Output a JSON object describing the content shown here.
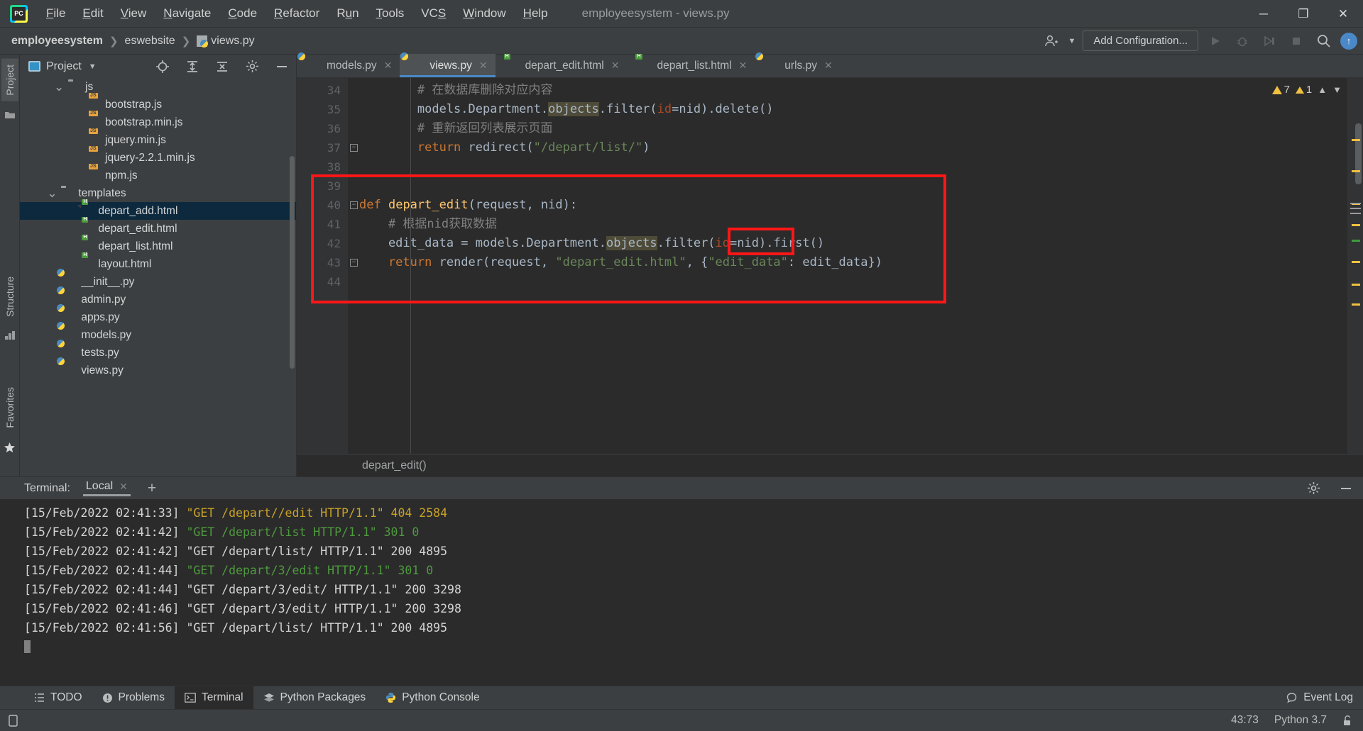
{
  "window": {
    "title": "employeesystem - views.py",
    "logo": "pycharm-logo",
    "controls": {
      "minimize": "─",
      "maximize": "❐",
      "close": "✕"
    }
  },
  "menu": [
    {
      "label": "File",
      "mnemonic": "F"
    },
    {
      "label": "Edit",
      "mnemonic": "E"
    },
    {
      "label": "View",
      "mnemonic": "V"
    },
    {
      "label": "Navigate",
      "mnemonic": "N"
    },
    {
      "label": "Code",
      "mnemonic": "C"
    },
    {
      "label": "Refactor",
      "mnemonic": "R"
    },
    {
      "label": "Run",
      "mnemonic": "u"
    },
    {
      "label": "Tools",
      "mnemonic": "T"
    },
    {
      "label": "VCS",
      "mnemonic": "S"
    },
    {
      "label": "Window",
      "mnemonic": "W"
    },
    {
      "label": "Help",
      "mnemonic": "H"
    }
  ],
  "navbar": {
    "breadcrumbs": [
      "employeesystem",
      "eswebsite",
      "views.py"
    ],
    "add_configuration": "Add Configuration...",
    "icons": [
      "user-icon",
      "run-icon",
      "debug-icon",
      "coverage-icon",
      "stop-icon",
      "search-icon",
      "updates-icon"
    ]
  },
  "sidebar": {
    "rail_tabs": [
      "Project",
      "Structure",
      "Favorites"
    ],
    "panel_title": "Project",
    "tools": [
      "locate-icon",
      "expand-all-icon",
      "collapse-all-icon",
      "settings-icon",
      "hide-icon"
    ],
    "tree": [
      {
        "label": "js",
        "type": "folder",
        "indent": 2,
        "expanded": true,
        "selected": false
      },
      {
        "label": "bootstrap.js",
        "type": "js",
        "indent": 4,
        "selected": false
      },
      {
        "label": "bootstrap.min.js",
        "type": "js",
        "indent": 4,
        "selected": false
      },
      {
        "label": "jquery.min.js",
        "type": "js",
        "indent": 4,
        "selected": false
      },
      {
        "label": "jquery-2.2.1.min.js",
        "type": "js",
        "indent": 4,
        "selected": false
      },
      {
        "label": "npm.js",
        "type": "js",
        "indent": 4,
        "selected": false
      },
      {
        "label": "templates",
        "type": "folder",
        "indent": 1.6,
        "expanded": true,
        "selected": false
      },
      {
        "label": "depart_add.html",
        "type": "html",
        "indent": 3.6,
        "selected": true
      },
      {
        "label": "depart_edit.html",
        "type": "html",
        "indent": 3.6,
        "selected": false
      },
      {
        "label": "depart_list.html",
        "type": "html",
        "indent": 3.6,
        "selected": false
      },
      {
        "label": "layout.html",
        "type": "html",
        "indent": 3.6,
        "selected": false
      },
      {
        "label": "__init__.py",
        "type": "py",
        "indent": 2.6,
        "selected": false
      },
      {
        "label": "admin.py",
        "type": "py",
        "indent": 2.6,
        "selected": false
      },
      {
        "label": "apps.py",
        "type": "py",
        "indent": 2.6,
        "selected": false
      },
      {
        "label": "models.py",
        "type": "py",
        "indent": 2.6,
        "selected": false
      },
      {
        "label": "tests.py",
        "type": "py",
        "indent": 2.6,
        "selected": false
      },
      {
        "label": "views.py",
        "type": "py",
        "indent": 2.6,
        "selected": false
      }
    ]
  },
  "editor": {
    "tabs": [
      {
        "label": "models.py",
        "type": "py",
        "active": false,
        "closable": true
      },
      {
        "label": "views.py",
        "type": "py",
        "active": true,
        "closable": true
      },
      {
        "label": "depart_edit.html",
        "type": "html",
        "active": false,
        "closable": true
      },
      {
        "label": "depart_list.html",
        "type": "html",
        "active": false,
        "closable": true
      },
      {
        "label": "urls.py",
        "type": "py",
        "active": false,
        "closable": true
      }
    ],
    "inspections": {
      "warnings": "7",
      "weak_warnings": "1"
    },
    "first_line_number": 34,
    "lines": [
      {
        "n": 34,
        "fold": false,
        "tokens": [
          {
            "t": "        # ",
            "c": "com"
          },
          {
            "t": "在数据库删除对应内容",
            "c": "com"
          }
        ]
      },
      {
        "n": 35,
        "fold": false,
        "tokens": [
          {
            "t": "        models.Department.",
            "c": "id"
          },
          {
            "t": "objects",
            "c": "hl"
          },
          {
            "t": ".filter(",
            "c": "id"
          },
          {
            "t": "id",
            "c": "arg"
          },
          {
            "t": "=nid).delete()",
            "c": "id"
          }
        ]
      },
      {
        "n": 36,
        "fold": false,
        "tokens": [
          {
            "t": "        # ",
            "c": "com"
          },
          {
            "t": "重新返回列表展示页面",
            "c": "com"
          }
        ]
      },
      {
        "n": 37,
        "fold": true,
        "tokens": [
          {
            "t": "        return",
            "c": "kw"
          },
          {
            "t": " redirect(",
            "c": "id"
          },
          {
            "t": "\"/depart/list/\"",
            "c": "str"
          },
          {
            "t": ")",
            "c": "id"
          }
        ]
      },
      {
        "n": 38,
        "fold": false,
        "tokens": []
      },
      {
        "n": 39,
        "fold": false,
        "tokens": []
      },
      {
        "n": 40,
        "fold": true,
        "tokens": [
          {
            "t": "def",
            "c": "def"
          },
          {
            "t": " ",
            "c": "id"
          },
          {
            "t": "depart_edit",
            "c": "fn"
          },
          {
            "t": "(request, nid):",
            "c": "id"
          }
        ]
      },
      {
        "n": 41,
        "fold": false,
        "tokens": [
          {
            "t": "    # ",
            "c": "com"
          },
          {
            "t": "根据nid获取数据",
            "c": "com"
          }
        ]
      },
      {
        "n": 42,
        "fold": false,
        "tokens": [
          {
            "t": "    edit_data = models.Department.",
            "c": "id"
          },
          {
            "t": "objects",
            "c": "hl"
          },
          {
            "t": ".filter(",
            "c": "id"
          },
          {
            "t": "id",
            "c": "arg"
          },
          {
            "t": "=nid).",
            "c": "id"
          },
          {
            "t": "first()",
            "c": "id"
          }
        ]
      },
      {
        "n": 43,
        "fold": true,
        "tokens": [
          {
            "t": "    return",
            "c": "kw"
          },
          {
            "t": " render(request, ",
            "c": "id"
          },
          {
            "t": "\"depart_edit.html\"",
            "c": "str"
          },
          {
            "t": ", {",
            "c": "id"
          },
          {
            "t": "\"edit_data\"",
            "c": "str"
          },
          {
            "t": ": edit_data})",
            "c": "id"
          }
        ]
      },
      {
        "n": 44,
        "fold": false,
        "tokens": []
      }
    ],
    "annotation_box_label": "red-highlight-rectangle",
    "annotation_inner_label": "first()",
    "status_breadcrumb": "depart_edit()"
  },
  "terminal": {
    "label": "Terminal:",
    "tab": "Local",
    "add_button": "+",
    "tools": [
      "settings-icon",
      "hide-icon"
    ],
    "lines": [
      {
        "ts": "[15/Feb/2022 02:41:33]",
        "req": " \"GET /depart//edit HTTP/1.1\" 404 2584",
        "color": "yellow"
      },
      {
        "ts": "[15/Feb/2022 02:41:42]",
        "req": " \"GET /depart/list HTTP/1.1\" 301 0",
        "color": "green"
      },
      {
        "ts": "[15/Feb/2022 02:41:42]",
        "req": " \"GET /depart/list/ HTTP/1.1\" 200 4895",
        "color": "white"
      },
      {
        "ts": "[15/Feb/2022 02:41:44]",
        "req": " \"GET /depart/3/edit HTTP/1.1\" 301 0",
        "color": "green"
      },
      {
        "ts": "[15/Feb/2022 02:41:44]",
        "req": " \"GET /depart/3/edit/ HTTP/1.1\" 200 3298",
        "color": "white"
      },
      {
        "ts": "[15/Feb/2022 02:41:46]",
        "req": " \"GET /depart/3/edit/ HTTP/1.1\" 200 3298",
        "color": "white"
      },
      {
        "ts": "[15/Feb/2022 02:41:56]",
        "req": " \"GET /depart/list/ HTTP/1.1\" 200 4895",
        "color": "white"
      }
    ]
  },
  "bottom_toolbar": {
    "items": [
      {
        "label": "TODO",
        "icon": "todo-icon",
        "active": false
      },
      {
        "label": "Problems",
        "icon": "problems-icon",
        "active": false
      },
      {
        "label": "Terminal",
        "icon": "terminal-icon",
        "active": true
      },
      {
        "label": "Python Packages",
        "icon": "packages-icon",
        "active": false
      },
      {
        "label": "Python Console",
        "icon": "python-console-icon",
        "active": false
      }
    ],
    "event_log": "Event Log"
  },
  "statusbar": {
    "caret_position": "43:73",
    "interpreter": "Python 3.7",
    "lock_icon": "unlocked-icon"
  },
  "colors": {
    "accent": "#4a88c7",
    "annotation": "#ff1616",
    "editor_bg": "#2b2b2b",
    "panel_bg": "#3c3f41",
    "selection": "#0d293e"
  }
}
